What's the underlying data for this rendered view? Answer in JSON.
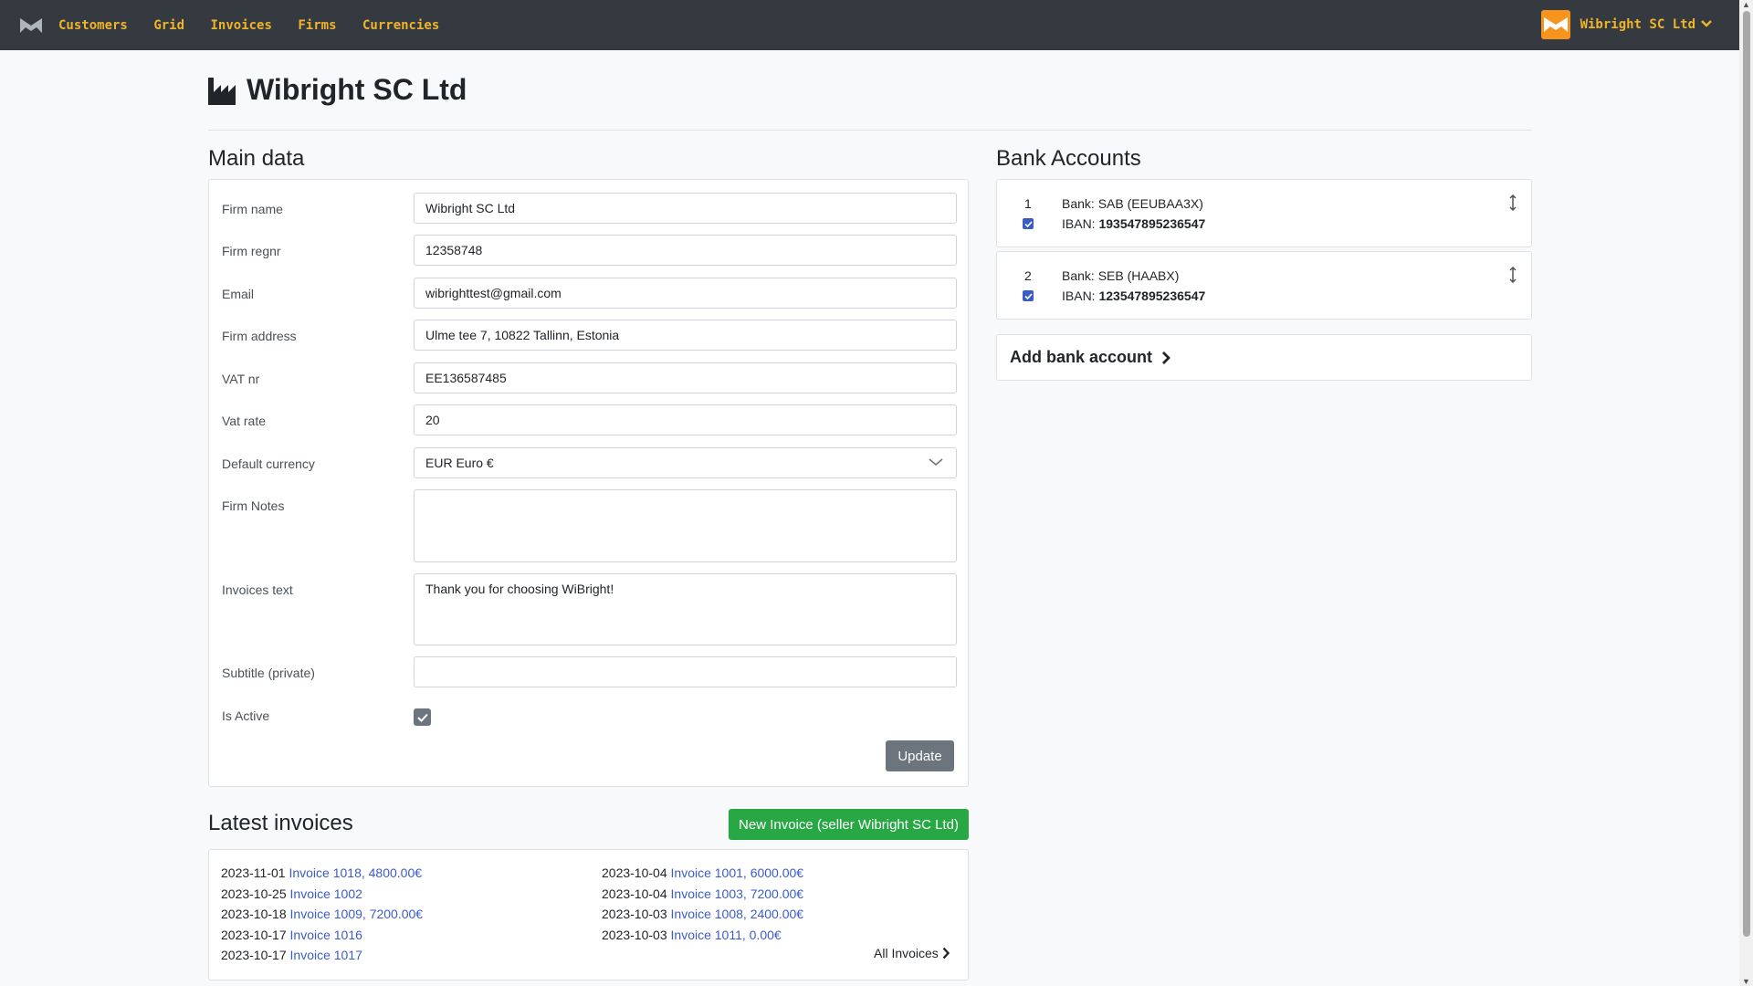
{
  "nav": {
    "items": [
      "Customers",
      "Grid",
      "Invoices",
      "Firms",
      "Currencies"
    ],
    "brand": "Wibright SC Ltd"
  },
  "page": {
    "title": "Wibright SC Ltd"
  },
  "main": {
    "heading": "Main data",
    "fields": {
      "firm_name": {
        "label": "Firm name",
        "value": "Wibright SC Ltd"
      },
      "firm_regnr": {
        "label": "Firm regnr",
        "value": "12358748"
      },
      "email": {
        "label": "Email",
        "value": "wibrighttest@gmail.com"
      },
      "firm_address": {
        "label": "Firm address",
        "value": "Ulme tee 7, 10822 Tallinn, Estonia"
      },
      "vat_nr": {
        "label": "VAT nr",
        "value": "EE136587485"
      },
      "vat_rate": {
        "label": "Vat rate",
        "value": "20"
      },
      "default_currency": {
        "label": "Default currency",
        "value": "EUR Euro €"
      },
      "firm_notes": {
        "label": "Firm Notes",
        "value": ""
      },
      "invoices_text": {
        "label": "Invoices text",
        "value": "Thank you for choosing WiBright!"
      },
      "subtitle": {
        "label": "Subtitle (private)",
        "value": ""
      },
      "is_active": {
        "label": "Is Active",
        "checked": true
      }
    },
    "update_label": "Update"
  },
  "banks": {
    "heading": "Bank Accounts",
    "accounts": [
      {
        "num": "1",
        "bank_prefix": "Bank:",
        "bank": "SAB (EEUBAA3X)",
        "iban_prefix": "IBAN:",
        "iban": "193547895236547"
      },
      {
        "num": "2",
        "bank_prefix": "Bank:",
        "bank": "SEB (HAABX)",
        "iban_prefix": "IBAN:",
        "iban": "123547895236547"
      }
    ],
    "add_label": "Add bank account"
  },
  "latest": {
    "heading": "Latest invoices",
    "new_label": "New Invoice (seller Wibright SC Ltd)",
    "left": [
      {
        "date": "2023-11-01",
        "link": "Invoice 1018, 4800.00€"
      },
      {
        "date": "2023-10-25",
        "link": "Invoice 1002"
      },
      {
        "date": "2023-10-18",
        "link": "Invoice 1009, 7200.00€"
      },
      {
        "date": "2023-10-17",
        "link": "Invoice 1016"
      },
      {
        "date": "2023-10-17",
        "link": "Invoice 1017"
      }
    ],
    "right": [
      {
        "date": "2023-10-04",
        "link": "Invoice 1001, 6000.00€"
      },
      {
        "date": "2023-10-04",
        "link": "Invoice 1003, 7200.00€"
      },
      {
        "date": "2023-10-03",
        "link": "Invoice 1008, 2400.00€"
      },
      {
        "date": "2023-10-03",
        "link": "Invoice 1011, 0.00€"
      }
    ],
    "all_label": "All Invoices"
  }
}
